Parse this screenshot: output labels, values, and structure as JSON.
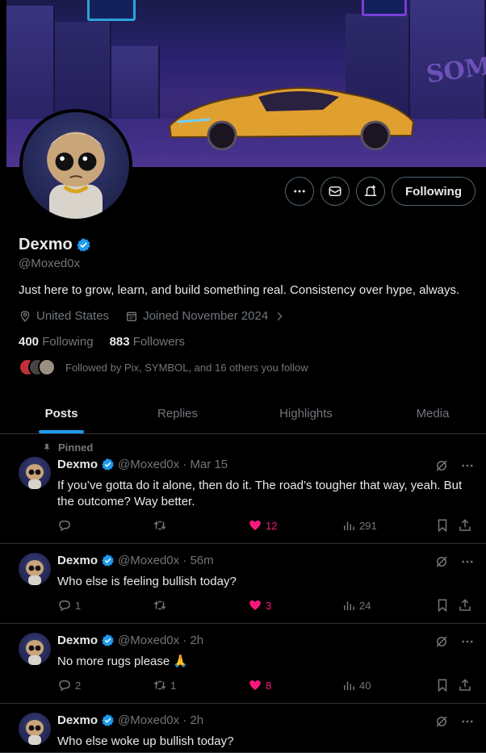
{
  "profile": {
    "name": "Dexmo",
    "handle": "@Moxed0x",
    "bio": "Just here to grow, learn, and build something real. Consistency over hype, always.",
    "location": "United States",
    "joined": "Joined November 2024",
    "following_count": "400",
    "following_label": "Following",
    "followers_count": "883",
    "followers_label": "Followers",
    "followed_by": "Followed by Pix, SYMBOL, and 16 others you follow",
    "follow_button": "Following",
    "banner_sign": "SOM"
  },
  "tabs": [
    {
      "label": "Posts",
      "active": true
    },
    {
      "label": "Replies",
      "active": false
    },
    {
      "label": "Highlights",
      "active": false
    },
    {
      "label": "Media",
      "active": false
    }
  ],
  "posts": [
    {
      "pinned_label": "Pinned",
      "name": "Dexmo",
      "meta": "@Moxed0x · Mar 15",
      "line1": "If you’ve gotta do it alone, then do it. The road’s tougher that way, yeah. But",
      "line2": "the outcome? Way better.",
      "replies": "",
      "reposts": "",
      "likes": "12",
      "views": "291"
    },
    {
      "name": "Dexmo",
      "meta": "@Moxed0x · 56m",
      "line1": "Who else is feeling bullish today?",
      "replies": "1",
      "reposts": "",
      "likes": "3",
      "views": "24"
    },
    {
      "name": "Dexmo",
      "meta": "@Moxed0x · 2h",
      "line1": "No more rugs please 🙏",
      "replies": "2",
      "reposts": "1",
      "likes": "8",
      "views": "40"
    },
    {
      "name": "Dexmo",
      "meta": "@Moxed0x · 2h",
      "line1": "Who else woke up bullish today?"
    }
  ],
  "colors": {
    "accent": "#1d9bf0",
    "like": "#f91880",
    "muted": "#71767b",
    "border": "#2f3336"
  }
}
